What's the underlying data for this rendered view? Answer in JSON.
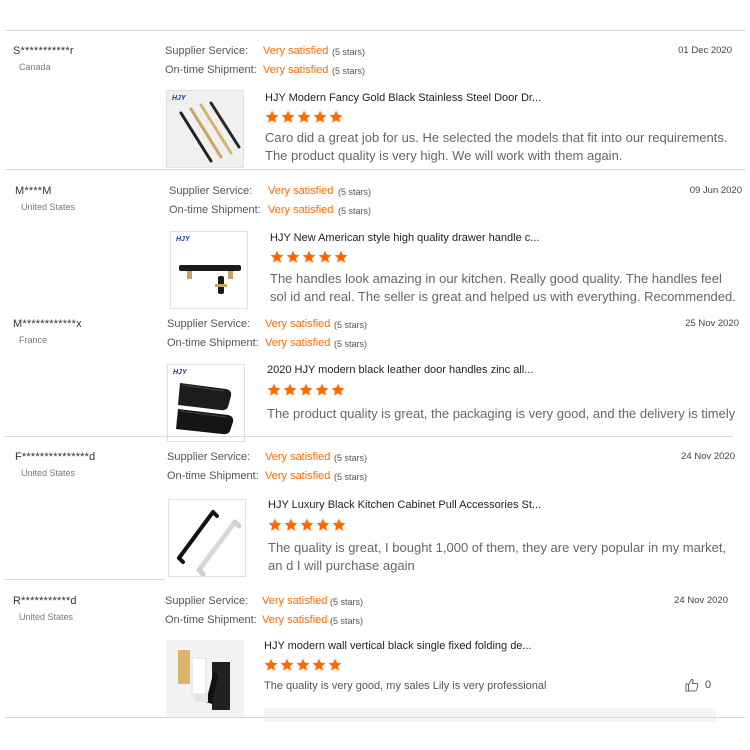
{
  "labels": {
    "supplier_service": "Supplier Service:",
    "ontime_shipment": "On-time Shipment:"
  },
  "reviews": [
    {
      "user": "S***********r",
      "country": "Canada",
      "supplier_value": "Very satisfied",
      "supplier_note": "(5 stars)",
      "shipment_value": "Very satisfied",
      "shipment_note": "(5 stars)",
      "date": "01 Dec 2020",
      "product_title": "HJY Modern Fancy Gold Black Stainless Steel Door Dr...",
      "rating": 5,
      "text": "Caro did a great job for us. He selected the models that fit into our requirements. The product quality is very high. We will work with them again.",
      "thumb_brand": "HJY"
    },
    {
      "user": "M****M",
      "country": "United States",
      "supplier_value": "Very satisfied",
      "supplier_note": "(5 stars)",
      "shipment_value": "Very satisfied",
      "shipment_note": "(5 stars)",
      "date": "09 Jun 2020",
      "product_title": "HJY New American style high quality drawer handle c...",
      "rating": 5,
      "text": "The handles look amazing in our kitchen. Really good quality. The handles feel sol id and real. The seller is great and helped us with everything. Recommended.",
      "thumb_brand": "HJY"
    },
    {
      "user": "M************x",
      "country": "France",
      "supplier_value": "Very satisfied",
      "supplier_note": "(5 stars)",
      "shipment_value": "Very satisfied",
      "shipment_note": "(5 stars)",
      "date": "25 Nov 2020",
      "product_title": "2020 HJY modern black leather door handles zinc all...",
      "rating": 5,
      "text": "The product quality is great, the packaging is very good, and the delivery is timely",
      "thumb_brand": "HJY"
    },
    {
      "user": "F***************d",
      "country": "United States",
      "supplier_value": "Very satisfied",
      "supplier_note": "(5 stars)",
      "shipment_value": "Very satisfied",
      "shipment_note": "(5 stars)",
      "date": "24 Nov 2020",
      "product_title": "HJY Luxury Black Kitchen Cabinet Pull Accessories St...",
      "rating": 5,
      "text": "The quality is great, I bought 1,000 of them, they are very popular in my market, an d I will purchase again"
    },
    {
      "user": "R***********d",
      "country": "United States",
      "supplier_value": "Very satisfied",
      "supplier_note": "(5 stars)",
      "shipment_value": "Very satisfied",
      "shipment_note": "(5 stars)",
      "date": "24 Nov 2020",
      "product_title": "HJY modern wall vertical black single fixed folding de...",
      "rating": 5,
      "text": "The quality is very good, my sales Lily is very professional",
      "likes": "0"
    }
  ],
  "colors": {
    "accent": "#ff6a00",
    "star": "#ff6a00",
    "separator": "#d9d9d9"
  }
}
